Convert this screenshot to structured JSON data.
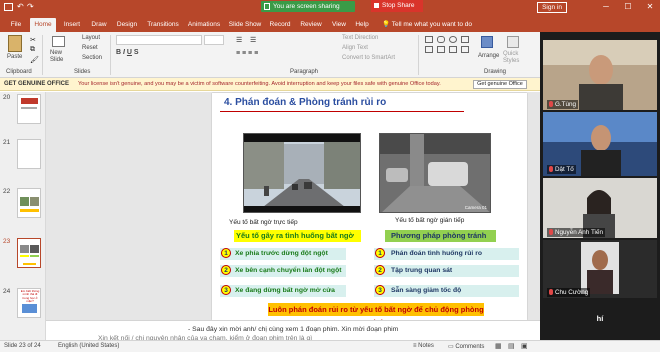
{
  "titlebar": {
    "share_status": "You are screen sharing",
    "stop_share": "Stop Share",
    "sign_in": "Sign in",
    "window_controls": [
      "─",
      "☐",
      "✕"
    ]
  },
  "tabs": [
    "File",
    "Home",
    "Insert",
    "Draw",
    "Design",
    "Transitions",
    "Animations",
    "Slide Show",
    "Record",
    "Review",
    "View",
    "Help"
  ],
  "active_tab": "Home",
  "tell_me": "Tell me what you want to do",
  "ribbon": {
    "paste": "Paste",
    "new_slide": "New Slide",
    "layout": "Layout",
    "reset": "Reset",
    "section": "Section",
    "text_direction": "Text Direction",
    "align_text": "Align Text",
    "convert_smartart": "Convert to SmartArt",
    "arrange": "Arrange",
    "quick_styles": "Quick Styles",
    "groups": [
      "Clipboard",
      "Slides",
      "Paragraph",
      "Drawing"
    ]
  },
  "warning": {
    "title": "GET GENUINE OFFICE",
    "message": "Your license isn't genuine, and you may be a victim of software counterfeiting. Avoid interruption and keep your files safe with genuine Office today.",
    "button": "Get genuine Office"
  },
  "thumbnails": [
    {
      "num": "20"
    },
    {
      "num": "21"
    },
    {
      "num": "22"
    },
    {
      "num": "23"
    },
    {
      "num": "24",
      "caption": "Em biết thông minh thà đi trong học ở mặn?"
    }
  ],
  "slide": {
    "title": "4. Phán đoán & Phòng tránh rủi ro",
    "left_caption": "Yếu tố bất ngờ trực tiếp",
    "right_caption": "Yếu tố bất ngờ gián tiếp",
    "left_heading": "Yếu tố gây ra tình huống bất ngờ",
    "right_heading": "Phương pháp phòng tránh",
    "left_items": [
      {
        "n": "1",
        "text": "Xe phía trước dừng đột ngột"
      },
      {
        "n": "2",
        "text": "Xe bên cạnh chuyển làn đột ngột"
      },
      {
        "n": "3",
        "text": "Xe đang dừng bất ngờ mở cửa"
      }
    ],
    "right_items": [
      {
        "n": "1",
        "text": "Phán đoán tình huống rủi ro"
      },
      {
        "n": "2",
        "text": "Tập trung quan sát"
      },
      {
        "n": "3",
        "text": "Sẵn sàng giảm tốc độ"
      }
    ],
    "conclusion": "Luôn phán đoán rủi ro từ yếu tố bất ngờ để chủ động phòng tránh",
    "camera_label": "Camera 01"
  },
  "notes": {
    "line1": "-    Sau đây xin mời anh/ chị cùng xem 1 đoạn phim. Xin mời đoạn phim",
    "line2": "Xin kết nối / chị nguyên nhân của va chạm, kiểm ở đoạn phim trên là gì"
  },
  "status": {
    "slide_info": "Slide 23 of 24",
    "language": "English (United States)",
    "notes": "Notes",
    "comments": "Comments"
  },
  "participants": [
    {
      "name": "G.Tùng"
    },
    {
      "name": "Dật Tố"
    },
    {
      "name": "Nguyễn Anh Tiến"
    },
    {
      "name": "Chu Cường"
    },
    {
      "name": "hí"
    }
  ],
  "colors": {
    "accent": "#b7472a",
    "share_green": "#3a9b47",
    "stop_red": "#d9342b",
    "slide_title": "#2b4ea0",
    "highlight_yellow": "#ffff00",
    "highlight_green": "#92d050",
    "conclusion_orange": "#ffc000"
  }
}
